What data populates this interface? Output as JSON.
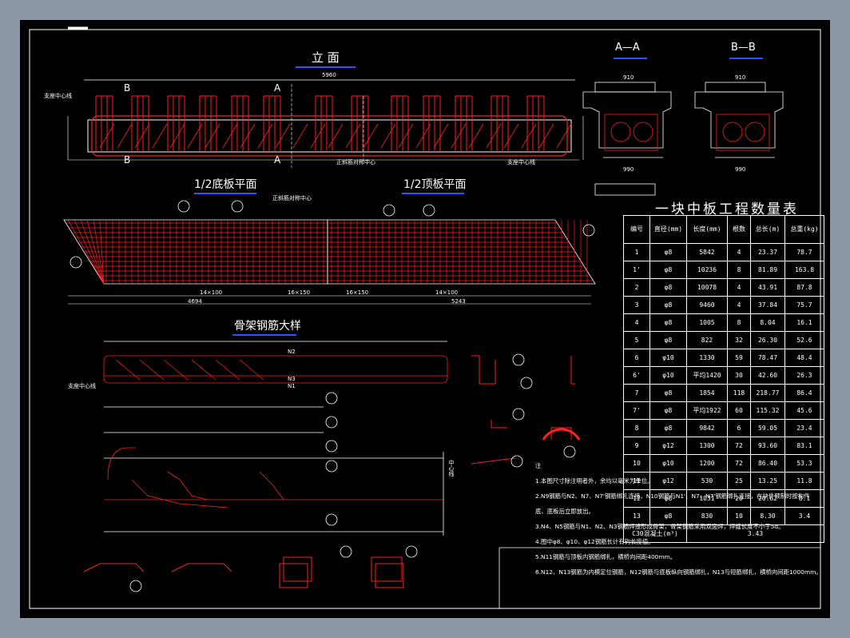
{
  "titles": {
    "elevation": "立 面",
    "section_a": "A—A",
    "section_b": "B—B",
    "half_bottom_plan": "1/2底板平面",
    "half_top_plan": "1/2顶板平面",
    "skeleton_detail": "骨架钢筋大样",
    "qty_table": "一块中板工程数量表"
  },
  "labels": {
    "total_length": "5960",
    "bearing_center_left": "支座中心线",
    "bearing_center_right": "支座中心线",
    "oblique_center": "正斜筋对称中心",
    "bottom_center": "正斜筋对称中心",
    "width_910": "910",
    "width_990": "990",
    "dim_4694": "4694",
    "dim_5243": "5243",
    "dim_14x100": "14×100",
    "dim_16x150": "16×150",
    "mark_b": "B",
    "mark_a": "A",
    "bar_n2": "N2",
    "bar_n3": "N3",
    "bar_n1": "N1",
    "center_line": "中心线",
    "zhu": "注"
  },
  "table": {
    "headers": [
      "编号",
      "直径(mm)",
      "长度(mm)",
      "根数",
      "总长(m)",
      "总重(kg)"
    ],
    "rows": [
      [
        "1",
        "φ8",
        "5842",
        "4",
        "23.37",
        "78.7"
      ],
      [
        "1'",
        "φ8",
        "10236",
        "8",
        "81.89",
        "163.8"
      ],
      [
        "2",
        "φ8",
        "10078",
        "4",
        "43.91",
        "87.8"
      ],
      [
        "3",
        "φ8",
        "9460",
        "4",
        "37.84",
        "75.7"
      ],
      [
        "4",
        "φ8",
        "1005",
        "8",
        "8.04",
        "16.1"
      ],
      [
        "5",
        "φ8",
        "822",
        "32",
        "26.30",
        "52.6"
      ],
      [
        "6",
        "φ10",
        "1330",
        "59",
        "78.47",
        "48.4"
      ],
      [
        "6'",
        "φ10",
        "平均1420",
        "30",
        "42.60",
        "26.3"
      ],
      [
        "7",
        "φ8",
        "1854",
        "118",
        "218.77",
        "86.4"
      ],
      [
        "7'",
        "φ8",
        "平均1922",
        "60",
        "115.32",
        "45.6"
      ],
      [
        "8",
        "φ8",
        "9842",
        "6",
        "59.05",
        "23.4"
      ],
      [
        "9",
        "φ12",
        "1300",
        "72",
        "93.60",
        "83.1"
      ],
      [
        "10",
        "φ10",
        "1200",
        "72",
        "86.40",
        "53.3"
      ],
      [
        "11",
        "φ12",
        "530",
        "25",
        "13.25",
        "11.8"
      ],
      [
        "12",
        "φ8",
        "1031",
        "20",
        "20.62",
        "8.1"
      ],
      [
        "13",
        "φ8",
        "830",
        "10",
        "8.30",
        "3.4"
      ]
    ],
    "footer_label": "C30混凝土(m³)",
    "footer_value": "3.43"
  },
  "notes": {
    "title": "注",
    "items": [
      "1.本图尺寸除注明者外，余均以毫米为单位。",
      "2.N9钢筋与N2、N7、N7'钢筋绑扎连接，N10钢筋与N1'、N7、N7'钢筋绑扎连接，在块件预制时按构件",
      "  底、底板后立即放出。",
      "3.N4、N5钢筋与N1、N2、N3钢筋焊接形成骨架，骨架钢筋采用双面焊，焊缝长度不小于5d。",
      "4.图中φ8、φ10、φ12钢筋长计有钩长度值。",
      "5.N11钢筋与顶板内钢筋绑扎，横桥向间距400mm。",
      "6.N12、N13钢筋为内模定位钢筋，N12钢筋与底板纵向钢筋绑扎，N13与短筋绑扎，横桥向间距1000mm。"
    ]
  },
  "colors": {
    "background": "#8d98a6",
    "sheet": "#000000",
    "rebar": "#ff2020",
    "line": "#ffffff",
    "accent": "#2c55ff"
  }
}
